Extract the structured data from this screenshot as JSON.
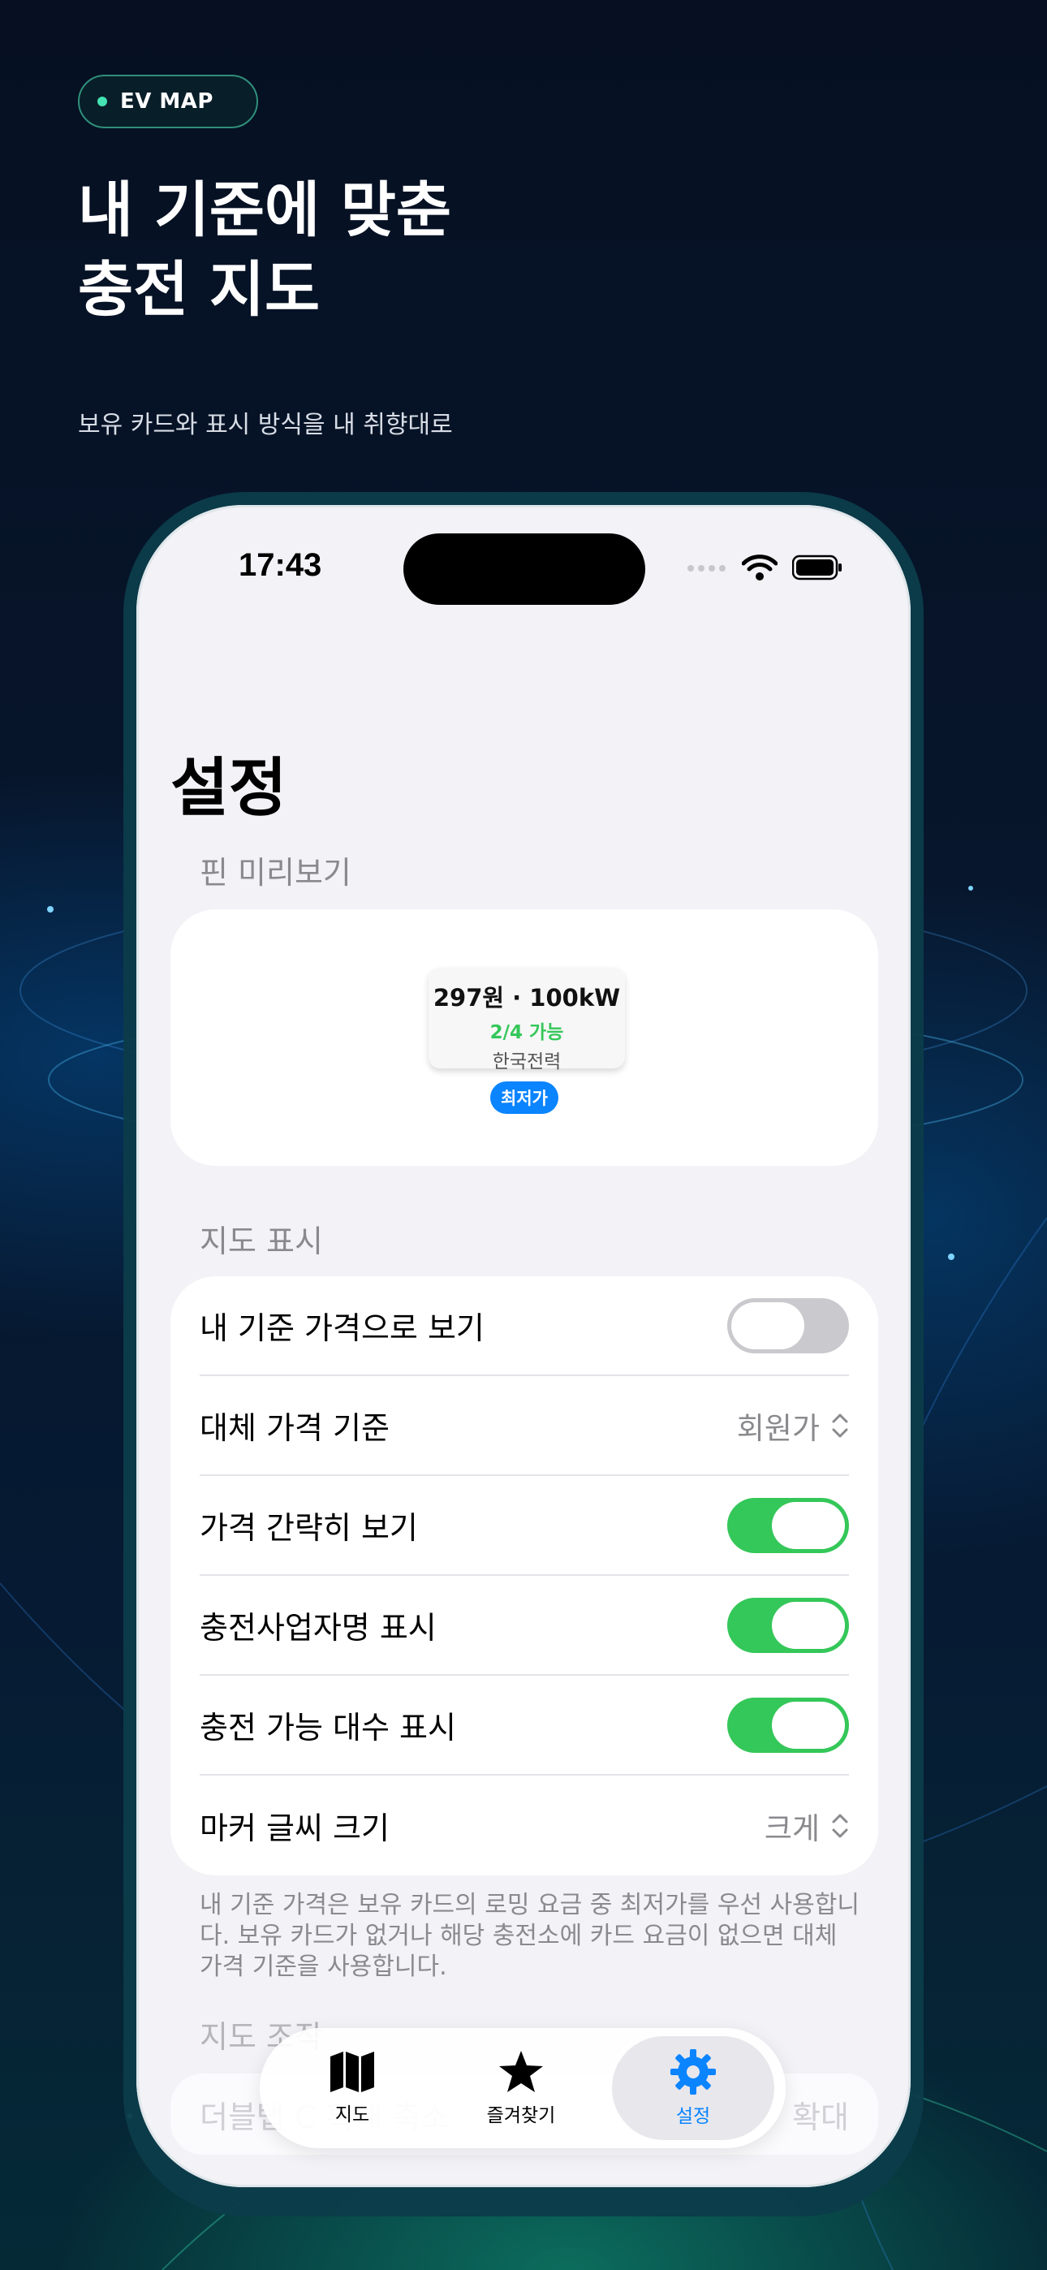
{
  "header": {
    "badge": "EV MAP",
    "headline_line1": "내 기준에 맞춘",
    "headline_line2": "충전 지도",
    "subheadline": "보유 카드와 표시 방식을 내 취향대로"
  },
  "status_bar": {
    "time": "17:43"
  },
  "page": {
    "title": "설정"
  },
  "pin_preview": {
    "section_label": "핀 미리보기",
    "price_line": "297원 · 100kW",
    "availability": "2/4 가능",
    "operator": "한국전력",
    "badge": "최저가"
  },
  "map_display": {
    "section_label": "지도 표시",
    "rows": [
      {
        "label": "내 기준 가격으로 보기",
        "type": "toggle",
        "on": false
      },
      {
        "label": "대체 가격 기준",
        "type": "picker",
        "value": "회원가"
      },
      {
        "label": "가격 간략히 보기",
        "type": "toggle",
        "on": true
      },
      {
        "label": "충전사업자명 표시",
        "type": "toggle",
        "on": true
      },
      {
        "label": "충전 가능 대수 표시",
        "type": "toggle",
        "on": true
      },
      {
        "label": "마커 글씨 크기",
        "type": "picker",
        "value": "크게"
      }
    ],
    "footnote": "내 기준 가격은 보유 카드의 로밍 요금 중 최저가를 우선 사용합니다. 보유 카드가 없거나 해당 충전소에 카드 요금이 없으면 대체 가격 기준을 사용합니다."
  },
  "map_controls": {
    "section_label": "지도 조작",
    "row_label": "더블탭 C 확대 축소",
    "row_value": "확대"
  },
  "tab_bar": {
    "tabs": [
      {
        "label": "지도",
        "icon": "map-icon",
        "active": false
      },
      {
        "label": "즐겨찾기",
        "icon": "star-icon",
        "active": false
      },
      {
        "label": "설정",
        "icon": "gear-icon",
        "active": true
      }
    ]
  },
  "colors": {
    "toggle_on": "#34c759",
    "accent": "#0a84ff",
    "badge_border": "#2f8f7a"
  }
}
